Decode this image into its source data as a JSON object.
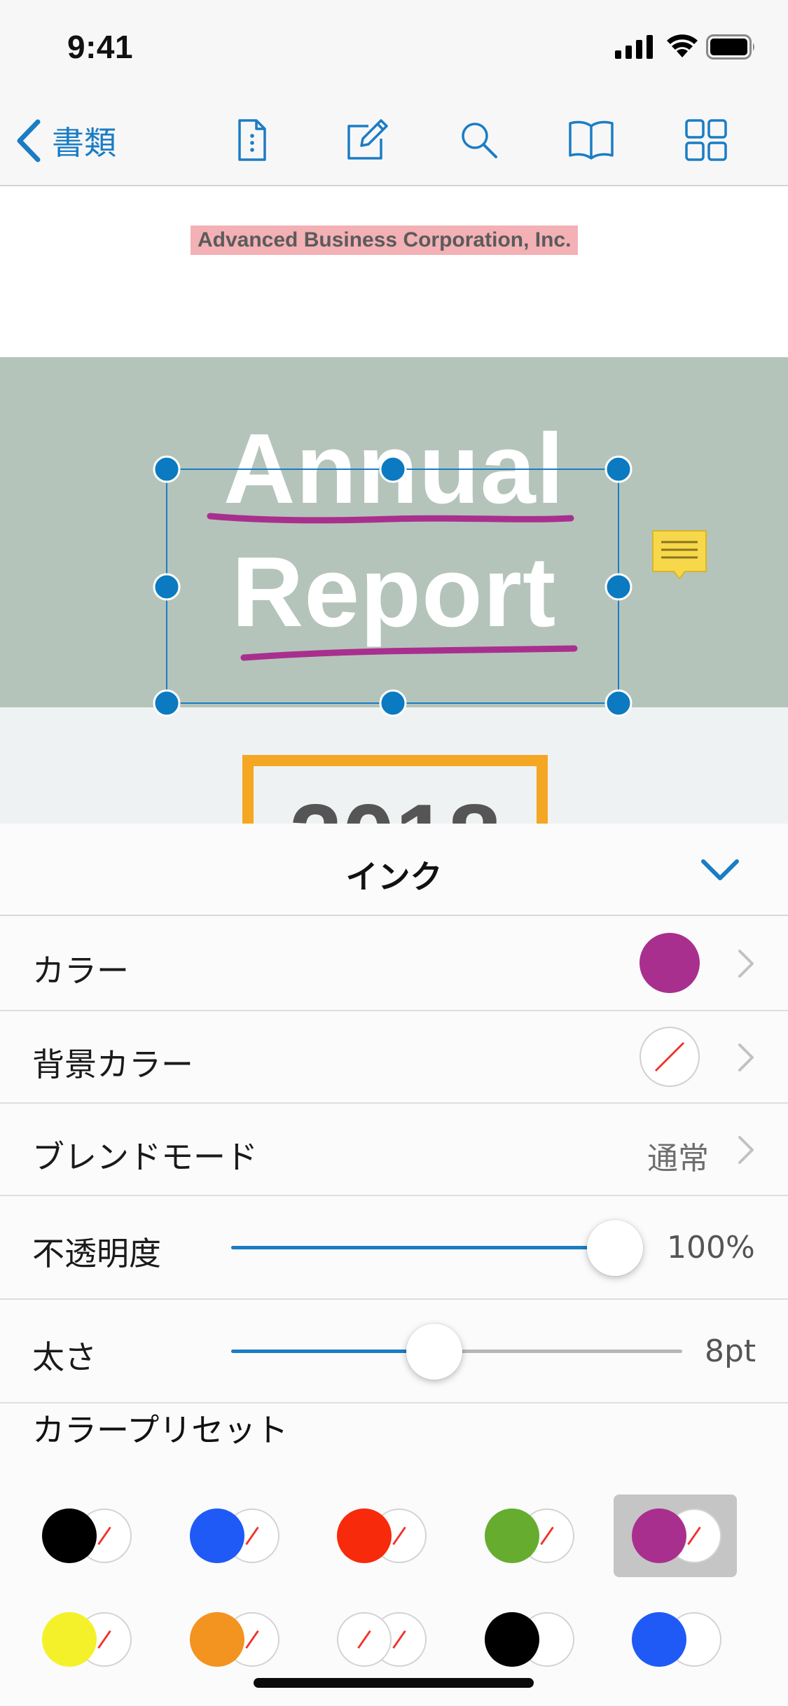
{
  "status_bar": {
    "time": "9:41",
    "icons": [
      "signal-icon",
      "wifi-icon",
      "battery-icon"
    ]
  },
  "toolbar": {
    "back_label": "書類",
    "tools": [
      "document-info-icon",
      "annotate-pencil-icon",
      "search-icon",
      "reader-book-icon",
      "thumbnails-grid-icon"
    ],
    "accent_color": "#1a7dc4"
  },
  "document": {
    "company": "Advanced Business Corporation, Inc.",
    "title_line_1": "Annual",
    "title_line_2": "Report",
    "year": "2018",
    "colors": {
      "cover_band": "#b4c4bb",
      "highlight": "#f3b1b5",
      "ink": "#a92f8e",
      "year_frame": "#f5a623",
      "note": "#f7d84a"
    }
  },
  "inspector": {
    "title": "インク",
    "color_label": "カラー",
    "color_value": "#a92f8e",
    "background_label": "背景カラー",
    "background_value": "none",
    "blend_label": "ブレンドモード",
    "blend_value": "通常",
    "opacity_label": "不透明度",
    "opacity_value": "100%",
    "opacity_fraction": 1.0,
    "thickness_label": "太さ",
    "thickness_value": "8pt",
    "thickness_fraction": 0.45,
    "presets_label": "カラープリセット",
    "presets": [
      {
        "fg": "#000000",
        "bg": "none",
        "selected": false
      },
      {
        "fg": "#1f5af6",
        "bg": "none",
        "selected": false
      },
      {
        "fg": "#f72a0b",
        "bg": "none",
        "selected": false
      },
      {
        "fg": "#66ad2f",
        "bg": "none",
        "selected": false
      },
      {
        "fg": "#a92f8e",
        "bg": "none",
        "selected": true
      },
      {
        "fg": "#f4f12a",
        "bg": "none",
        "selected": false
      },
      {
        "fg": "#f39320",
        "bg": "none",
        "selected": false
      },
      {
        "fg": "#ffffff",
        "bg": "none",
        "selected": false
      },
      {
        "fg": "#000000",
        "bg": "#ffffff",
        "selected": false
      },
      {
        "fg": "#1f5af6",
        "bg": "#ffffff",
        "selected": false
      }
    ]
  }
}
